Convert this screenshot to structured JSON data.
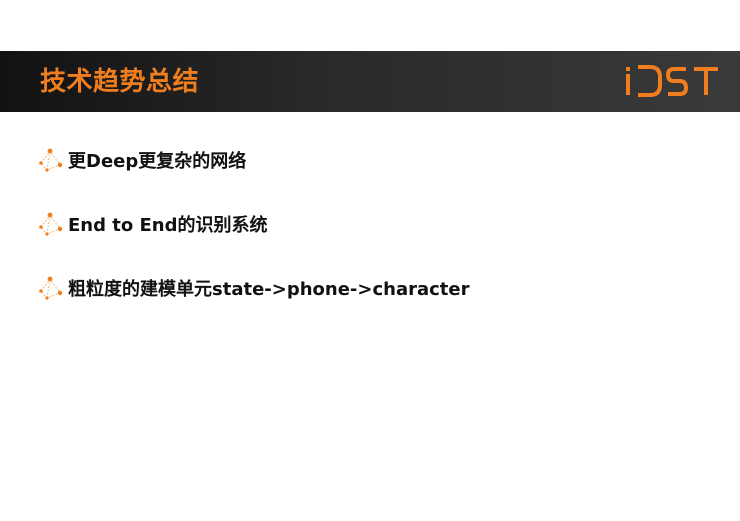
{
  "header": {
    "title": "技术趋势总结",
    "logo_text": "iDST",
    "accent_color": "#f07e1e",
    "band_color": "#1a1a1a"
  },
  "bullets": [
    {
      "icon": "network-nodes-icon",
      "text": "更Deep更复杂的网络"
    },
    {
      "icon": "network-nodes-icon",
      "text": "End to End的识别系统"
    },
    {
      "icon": "network-nodes-icon",
      "text": "粗粒度的建模单元state->phone->character"
    }
  ]
}
